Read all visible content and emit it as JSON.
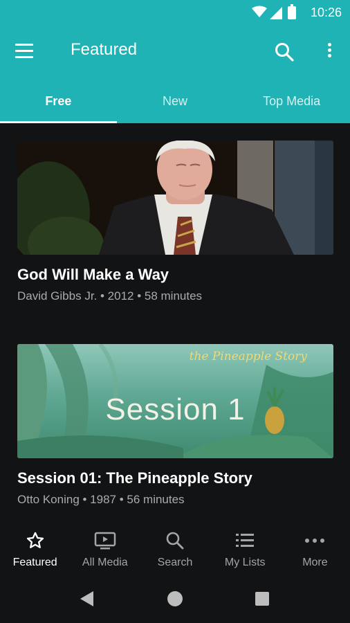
{
  "status_bar": {
    "time": "10:26"
  },
  "toolbar": {
    "title": "Featured"
  },
  "tabs": [
    {
      "label": "Free",
      "active": true
    },
    {
      "label": "New",
      "active": false
    },
    {
      "label": "Top Media",
      "active": false
    }
  ],
  "media": [
    {
      "title": "God Will Make a Way",
      "meta": "David Gibbs Jr. • 2012 • 58 minutes"
    },
    {
      "title": "Session 01: The Pineapple Story",
      "meta": "Otto Koning • 1987 • 56 minutes",
      "thumb_text": "Session 1",
      "thumb_logo": "the Pineapple Story"
    }
  ],
  "bottom_nav": [
    {
      "label": "Featured",
      "icon": "star-icon",
      "active": true
    },
    {
      "label": "All Media",
      "icon": "tv-play-icon",
      "active": false
    },
    {
      "label": "Search",
      "icon": "search-icon",
      "active": false
    },
    {
      "label": "My Lists",
      "icon": "list-icon",
      "active": false
    },
    {
      "label": "More",
      "icon": "more-horizontal-icon",
      "active": false
    }
  ],
  "colors": {
    "accent": "#1fb3b5",
    "background": "#121315",
    "meta_text": "#a9abae"
  }
}
